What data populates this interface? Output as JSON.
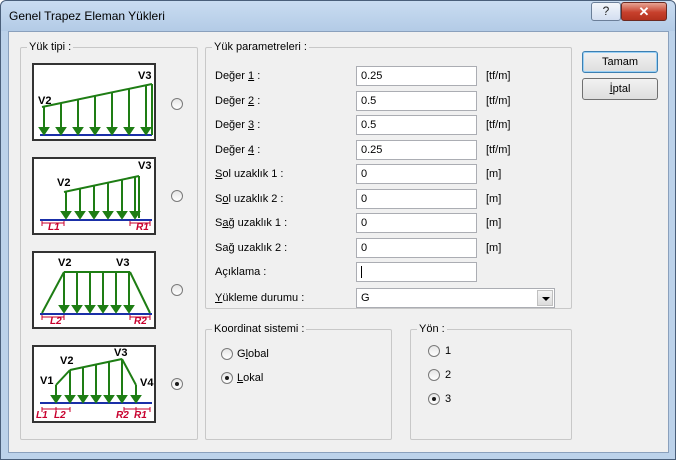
{
  "window": {
    "title": "Genel Trapez Eleman Yükleri",
    "help_label": "?",
    "close_label": "✕"
  },
  "load_type": {
    "label": "Yük tipi :",
    "diagrams": [
      {
        "name": "type1",
        "labels": {
          "v2": "V2",
          "v3": "V3"
        },
        "selected": false
      },
      {
        "name": "type2",
        "labels": {
          "v2": "V2",
          "v3": "V3",
          "l1": "L1",
          "r1": "R1"
        },
        "selected": false
      },
      {
        "name": "type3",
        "labels": {
          "v2": "V2",
          "v3": "V3",
          "l2": "L2",
          "r2": "R2"
        },
        "selected": false
      },
      {
        "name": "type4",
        "labels": {
          "v1": "V1",
          "v2": "V2",
          "v3": "V3",
          "v4": "V4",
          "l1": "L1",
          "l2": "L2",
          "r2": "R2",
          "r1": "R1"
        },
        "selected": true
      }
    ]
  },
  "params": {
    "label": "Yük parametreleri :",
    "rows": [
      {
        "pre": "Değer ",
        "ul": "1",
        "post": " :",
        "value": "0.25",
        "unit": "[tf/m]"
      },
      {
        "pre": "Değer ",
        "ul": "2",
        "post": " :",
        "value": "0.5",
        "unit": "[tf/m]"
      },
      {
        "pre": "Değer ",
        "ul": "3",
        "post": " :",
        "value": "0.5",
        "unit": "[tf/m]"
      },
      {
        "pre": "Değer ",
        "ul": "4",
        "post": " :",
        "value": "0.25",
        "unit": "[tf/m]"
      },
      {
        "pre": "",
        "ul": "S",
        "post": "ol uzaklık 1 :",
        "value": "0",
        "unit": "[m]"
      },
      {
        "pre": "S",
        "ul": "o",
        "post": "l uzaklık 2 :",
        "value": "0",
        "unit": "[m]"
      },
      {
        "pre": "S",
        "ul": "a",
        "post": "ğ uzaklık 1 :",
        "value": "0",
        "unit": "[m]"
      },
      {
        "pre": "Sa",
        "ul": "ğ",
        "post": " uzaklık 2 :",
        "value": "0",
        "unit": "[m]"
      }
    ],
    "description_label": "Açıklama :",
    "description_value": "",
    "loading_state_pre": "",
    "loading_state_ul": "Y",
    "loading_state_post": "ükleme durumu :",
    "loading_state_value": "G"
  },
  "coord": {
    "label": "Koordinat sistemi :",
    "options": [
      {
        "pre": "G",
        "ul": "l",
        "post": "obal",
        "selected": false
      },
      {
        "pre": "",
        "ul": "L",
        "post": "okal",
        "selected": true
      }
    ]
  },
  "direction": {
    "label": "Yön :",
    "options": [
      {
        "label": "1",
        "selected": false
      },
      {
        "label": "2",
        "selected": false
      },
      {
        "label": "3",
        "selected": true
      }
    ]
  },
  "buttons": {
    "ok_label": "Tamam",
    "cancel_pre": "",
    "cancel_ul": "İ",
    "cancel_post": "ptal"
  },
  "colors": {
    "arrow_green": "#1e7d14",
    "beam_blue": "#1a2fa8",
    "dim_red": "#c8002d"
  }
}
